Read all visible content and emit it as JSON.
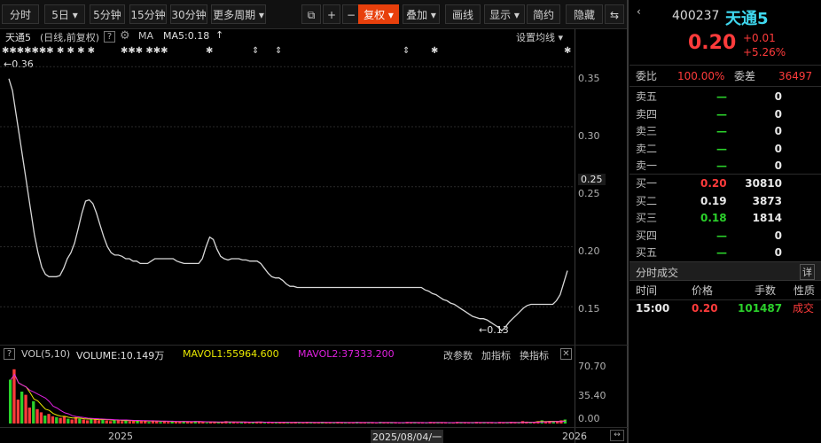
{
  "toolbar": {
    "buttons": [
      "分时",
      "5日",
      "5分钟",
      "15分钟",
      "30分钟",
      "更多周期",
      "复权",
      "叠加",
      "画线",
      "显示",
      "简约",
      "隐藏"
    ]
  },
  "chart_info": {
    "title": "天通5",
    "mode": "(日线,前复权)",
    "question": "?",
    "ma_label": "MA",
    "ma5": "MA5:0.18",
    "settings": "设置均线",
    "start_label": "←0.36",
    "low_label": "←0.13"
  },
  "price_axis": [
    "0.35",
    "0.30",
    "0.25",
    "0.25",
    "0.20",
    "0.15"
  ],
  "volume_bar": {
    "label": "VOL(5,10)",
    "volume": "VOLUME:10.149万",
    "mavol1": "MAVOL1:55964.600",
    "mavol2": "MAVOL2:37333.200",
    "links": [
      "改参数",
      "加指标",
      "换指标"
    ],
    "axis": [
      "70.70",
      "35.40",
      "0.00"
    ]
  },
  "time_axis": [
    "2025",
    "2025/08/04/一",
    "2026"
  ],
  "quote": {
    "code": "400237",
    "name": "天通5",
    "price": "0.20",
    "change": "+0.01",
    "change_pct": "+5.26%",
    "weibi_label": "委比",
    "weibi": "100.00%",
    "weicha_label": "委差",
    "weicha": "36497"
  },
  "asks": [
    {
      "label": "卖五",
      "price": "—",
      "vol": "0"
    },
    {
      "label": "卖四",
      "price": "—",
      "vol": "0"
    },
    {
      "label": "卖三",
      "price": "—",
      "vol": "0"
    },
    {
      "label": "卖二",
      "price": "—",
      "vol": "0"
    },
    {
      "label": "卖一",
      "price": "—",
      "vol": "0"
    }
  ],
  "bids": [
    {
      "label": "买一",
      "price": "0.20",
      "vol": "30810"
    },
    {
      "label": "买二",
      "price": "0.19",
      "vol": "3873"
    },
    {
      "label": "买三",
      "price": "0.18",
      "vol": "1814"
    },
    {
      "label": "买四",
      "price": "—",
      "vol": "0"
    },
    {
      "label": "买五",
      "price": "—",
      "vol": "0"
    }
  ],
  "trades": {
    "title": "分时成交",
    "detail": "详",
    "headers": [
      "时间",
      "价格",
      "手数",
      "性质"
    ],
    "rows": [
      {
        "time": "15:00",
        "price": "0.20",
        "volume": "101487",
        "type": "成交"
      }
    ]
  },
  "colors": {
    "up": "#ff3b3b",
    "down": "#2bd12b",
    "accent": "#e8400c",
    "mavol1": "#e8e800",
    "mavol2": "#e020e0"
  },
  "chart_data": {
    "type": "line",
    "series": [
      {
        "values": [
          0.34,
          0.33,
          0.31,
          0.29,
          0.27,
          0.25,
          0.23,
          0.21,
          0.195,
          0.183,
          0.177,
          0.175,
          0.175,
          0.175,
          0.176,
          0.182,
          0.19,
          0.195,
          0.203,
          0.215,
          0.228,
          0.238,
          0.239,
          0.236,
          0.228,
          0.218,
          0.208,
          0.2,
          0.195,
          0.193,
          0.193,
          0.192,
          0.19,
          0.19,
          0.188,
          0.188,
          0.186,
          0.186,
          0.186,
          0.188,
          0.19,
          0.19,
          0.19,
          0.19,
          0.19,
          0.19,
          0.188,
          0.187,
          0.186,
          0.186,
          0.186,
          0.186,
          0.186,
          0.19,
          0.2,
          0.208,
          0.206,
          0.198,
          0.192,
          0.19,
          0.189,
          0.19,
          0.19,
          0.19,
          0.189,
          0.189,
          0.188,
          0.188,
          0.188,
          0.186,
          0.182,
          0.178,
          0.175,
          0.174,
          0.174,
          0.172,
          0.169,
          0.167,
          0.167,
          0.166,
          0.166,
          0.166,
          0.166,
          0.166,
          0.166,
          0.166,
          0.166,
          0.166,
          0.166,
          0.166,
          0.166,
          0.166,
          0.166,
          0.166,
          0.166,
          0.166,
          0.166,
          0.166,
          0.166,
          0.166,
          0.166,
          0.166,
          0.166,
          0.166,
          0.166,
          0.166,
          0.166,
          0.166,
          0.166,
          0.166,
          0.166,
          0.166,
          0.166,
          0.166,
          0.164,
          0.163,
          0.161,
          0.16,
          0.158,
          0.156,
          0.155,
          0.153,
          0.152,
          0.15,
          0.148,
          0.146,
          0.144,
          0.142,
          0.141,
          0.14,
          0.14,
          0.139,
          0.137,
          0.135,
          0.133,
          0.13,
          0.133,
          0.137,
          0.14,
          0.143,
          0.146,
          0.149,
          0.151,
          0.152,
          0.152,
          0.152,
          0.152,
          0.152,
          0.152,
          0.152,
          0.155,
          0.16,
          0.17,
          0.18
        ]
      }
    ]
  }
}
